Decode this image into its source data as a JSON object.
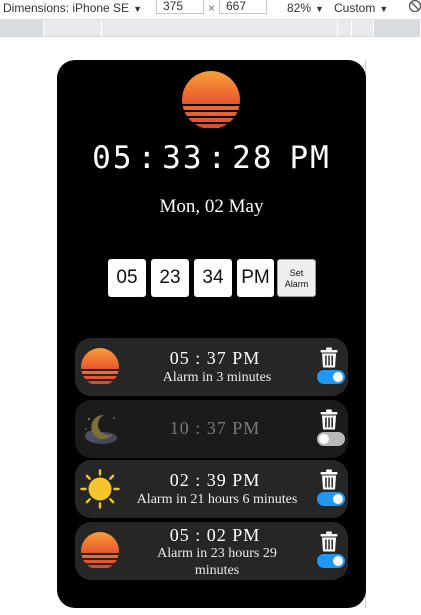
{
  "devtools": {
    "dimensions_label": "Dimensions: iPhone SE",
    "width": "375",
    "times": "×",
    "height": "667",
    "zoom": "82%",
    "throttle": "Custom"
  },
  "clock": {
    "hours": "05",
    "minutes": "33",
    "seconds": "28",
    "ampm": "PM",
    "separator": ":"
  },
  "date": "Mon, 02 May",
  "setter": {
    "hours": "05",
    "minutes": "23",
    "seconds": "34",
    "ampm": "PM",
    "button_line1": "Set",
    "button_line2": "Alarm"
  },
  "alarms": [
    {
      "time": "05 : 37 PM",
      "status": "Alarm in 3 minutes",
      "icon": "sunset-icon",
      "enabled": true
    },
    {
      "time": "10 : 37 PM",
      "status": "",
      "icon": "moon-icon",
      "enabled": false
    },
    {
      "time": "02 : 39 PM",
      "status": "Alarm in 21 hours 6 minutes",
      "icon": "sun-icon",
      "enabled": true
    },
    {
      "time": "05 : 02 PM",
      "status": "Alarm in 23 hours 29 minutes",
      "icon": "sunset-icon",
      "enabled": true
    }
  ],
  "colors": {
    "toggle_on": "#2196f3",
    "sunset_top": "#f9a23a",
    "sunset_bottom": "#e8542d",
    "sun": "#f6c52a"
  }
}
